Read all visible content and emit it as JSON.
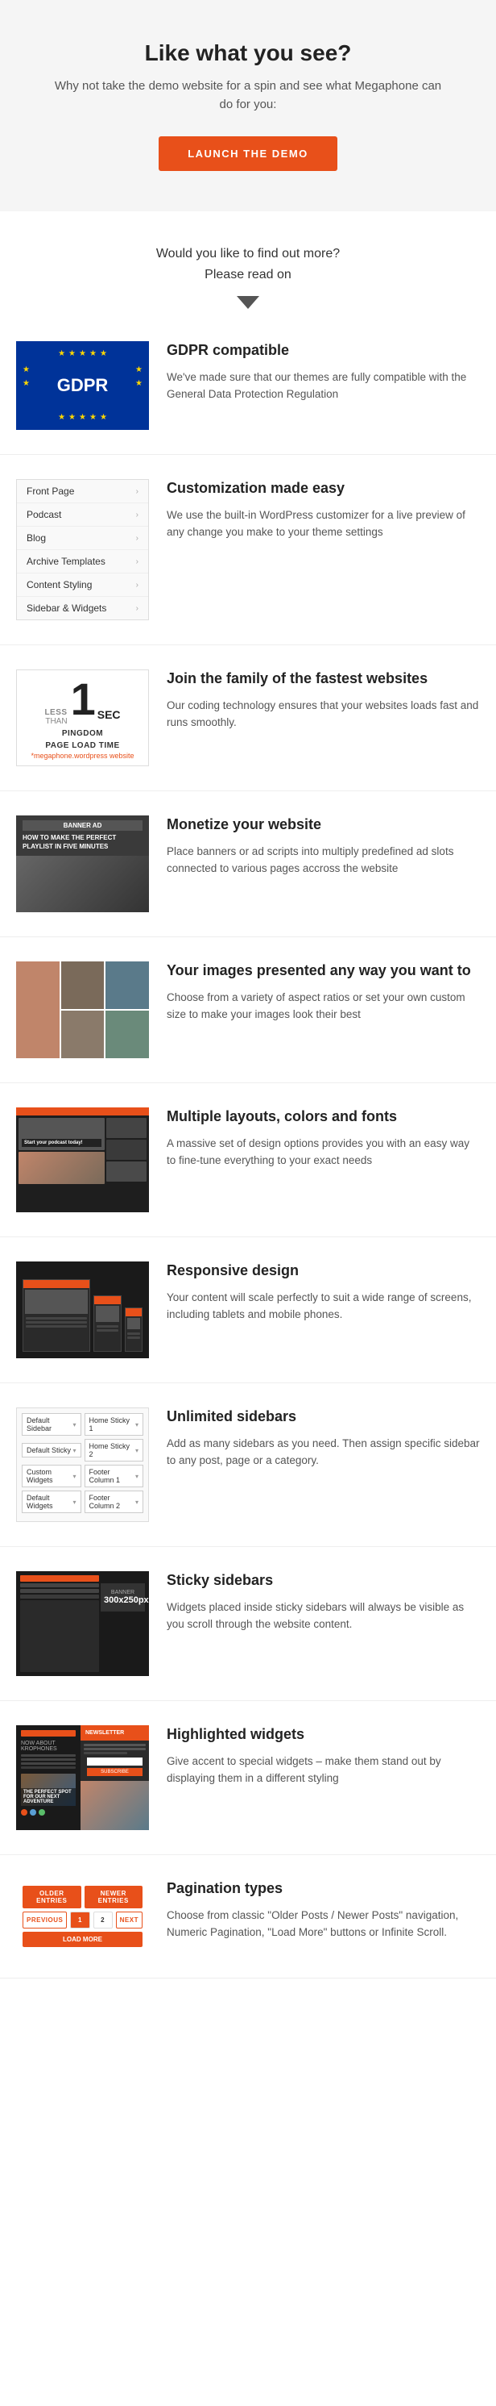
{
  "hero": {
    "heading": "Like what you see?",
    "description": "Why not take the demo website for a spin and see what Megaphone can do for you:",
    "button_label": "LAUNCH THE DEMO"
  },
  "find_out": {
    "line1": "Would you like to find out more?",
    "line2": "Please read on"
  },
  "features": [
    {
      "id": "gdpr",
      "title": "GDPR compatible",
      "description": "We've made sure that our themes are fully compatible with the General Data Protection Regulation"
    },
    {
      "id": "customization",
      "title": "Customization made easy",
      "description": "We use the built-in WordPress customizer for a live preview of any change you make to your theme settings",
      "menu_items": [
        "Front Page",
        "Podcast",
        "Blog",
        "Archive Templates",
        "Content Styling",
        "Sidebar & Widgets"
      ]
    },
    {
      "id": "speed",
      "title": "Join the family of the fastest websites",
      "description": "Our coding technology ensures that your websites loads fast and runs smoothly.",
      "speed_less": "LESS",
      "speed_than": "THAN",
      "speed_num": "1",
      "speed_sec": "SEC",
      "speed_label": "PINGDOM",
      "speed_sub_label": "PAGE LOAD TIME",
      "speed_link": "*megaphone.wordpress website"
    },
    {
      "id": "monetize",
      "title": "Monetize your website",
      "description": "Place banners or ad scripts into multiply predefined ad slots connected to various pages accross the website",
      "banner_ad_label": "BANNER AD",
      "banner_title": "HOW TO MAKE THE PERFECT PLAYLIST IN FIVE MINUTES"
    },
    {
      "id": "images",
      "title": "Your images presented any way you want to",
      "description": "Choose from a variety of aspect ratios or set your own custom size to make your images look their best"
    },
    {
      "id": "layouts",
      "title": "Multiple layouts, colors and fonts",
      "description": "A massive set of design options provides you with an easy way to fine-tune everything to your exact needs",
      "podcast_label": "Start your podcast today!"
    },
    {
      "id": "responsive",
      "title": "Responsive design",
      "description": "Your content will scale perfectly to suit a wide range of screens, including tablets and mobile phones."
    },
    {
      "id": "sidebars",
      "title": "Unlimited sidebars",
      "description": "Add as many sidebars as you need. Then assign specific sidebar to any post, page or a category.",
      "rows": [
        [
          "Default Sidebar",
          "Home Sticky 1"
        ],
        [
          "Default Sticky",
          "Home Sticky 2"
        ],
        [
          "Custom Widgets",
          "Footer Column 1"
        ],
        [
          "Default Widgets",
          "Footer Column 2"
        ]
      ]
    },
    {
      "id": "sticky",
      "title": "Sticky sidebars",
      "description": "Widgets placed inside sticky sidebars will always be visible as you scroll through the website content.",
      "banner_size": "300x250px"
    },
    {
      "id": "highlighted",
      "title": "Highlighted widgets",
      "description": "Give accent to special widgets – make them stand out by displaying them in a different styling",
      "dots": [
        "#e8501a",
        "#5a9fd4",
        "#5abd6a"
      ]
    },
    {
      "id": "pagination",
      "title": "Pagination types",
      "description": "Choose from classic \"Older Posts / Newer Posts\" navigation, Numeric Pagination, \"Load More\" buttons or Infinite Scroll.",
      "older": "OLDER ENTRIES",
      "newer": "NEWER ENTRIES",
      "previous": "PREVIOUS",
      "page1": "1",
      "page2": "2",
      "next": "NEXT",
      "load_more": "LOAD MORE"
    }
  ],
  "gdpr": {
    "text": "GDPR",
    "stars": [
      "★",
      "★",
      "★",
      "★",
      "★",
      "★",
      "★",
      "★",
      "★",
      "★",
      "★",
      "★"
    ]
  }
}
